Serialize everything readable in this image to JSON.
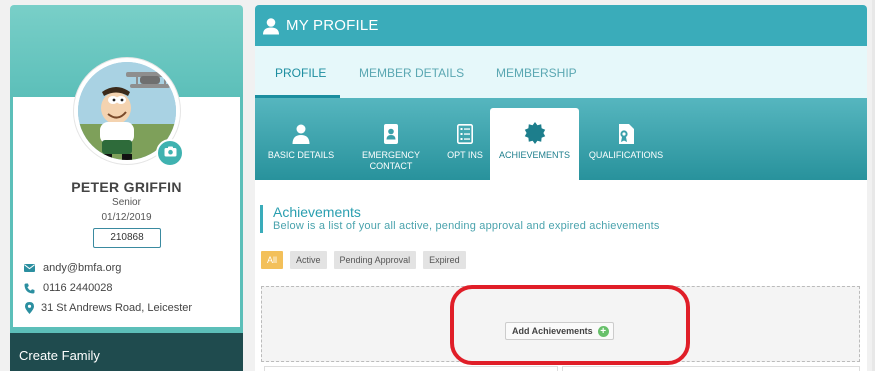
{
  "profile": {
    "name": "PETER GRIFFIN",
    "role": "Senior",
    "date": "01/12/2019",
    "member_number": "210868",
    "email": "andy@bmfa.org",
    "phone": "0116 2440028",
    "address": "31 St Andrews Road, Leicester",
    "create_family_label": "Create Family"
  },
  "header": {
    "title": "MY PROFILE",
    "icon": "user-icon"
  },
  "main_tabs": [
    {
      "label": "PROFILE",
      "active": true
    },
    {
      "label": "MEMBER DETAILS",
      "active": false
    },
    {
      "label": "MEMBERSHIP",
      "active": false
    }
  ],
  "sub_tabs": [
    {
      "label_line1": "BASIC DETAILS",
      "label_line2": "",
      "icon": "person-icon",
      "active": false
    },
    {
      "label_line1": "EMERGENCY",
      "label_line2": "CONTACT",
      "icon": "contact-book-icon",
      "active": false
    },
    {
      "label_line1": "OPT INS",
      "label_line2": "",
      "icon": "checklist-icon",
      "active": false
    },
    {
      "label_line1": "ACHIEVEMENTS",
      "label_line2": "",
      "icon": "badge-icon",
      "active": true
    },
    {
      "label_line1": "QUALIFICATIONS",
      "label_line2": "",
      "icon": "certificate-icon",
      "active": false
    }
  ],
  "achievements": {
    "title": "Achievements",
    "description": "Below is a list of your all active, pending approval and expired achievements",
    "filters": [
      {
        "label": "All",
        "active": true
      },
      {
        "label": "Active",
        "active": false
      },
      {
        "label": "Pending Approval",
        "active": false
      },
      {
        "label": "Expired",
        "active": false
      }
    ],
    "add_button_label": "Add Achievements"
  },
  "colors": {
    "header_teal": "#3aacba",
    "sidebar_teal": "#5cbfb9",
    "dark_footer": "#1f4b4e",
    "filter_active": "#f3c05a",
    "annotation_red": "#e01e28"
  }
}
